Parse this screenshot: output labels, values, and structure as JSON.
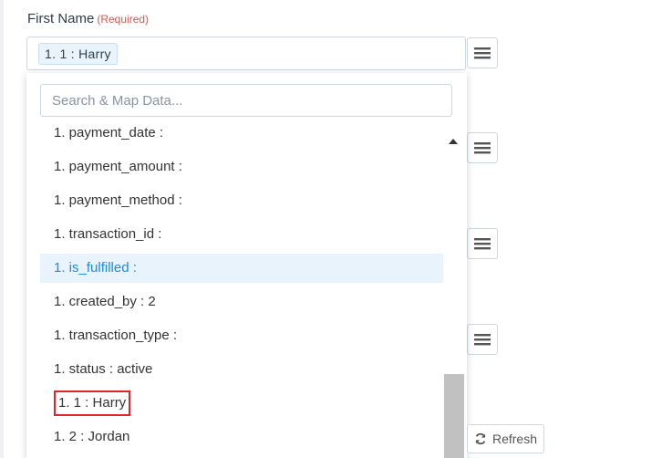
{
  "field": {
    "label": "First Name",
    "required_tag": "(Required)",
    "chip_value": "1. 1 : Harry"
  },
  "dropdown": {
    "search_placeholder": "Search & Map Data...",
    "items": [
      {
        "label": "1. payment_date :"
      },
      {
        "label": "1. payment_amount :"
      },
      {
        "label": "1. payment_method :"
      },
      {
        "label": "1. transaction_id :"
      },
      {
        "label": "1. is_fulfilled :",
        "highlighted": true
      },
      {
        "label": "1. created_by : 2"
      },
      {
        "label": "1. transaction_type :"
      },
      {
        "label": "1. status : active"
      },
      {
        "label": "1. 1 : Harry",
        "annotated": true
      },
      {
        "label": "1. 2 : Jordan"
      }
    ]
  },
  "buttons": {
    "refresh_label": "Refresh"
  },
  "icons": {
    "menu": "hamburger-menu-icon",
    "refresh": "refresh-icon",
    "scroll_up": "scroll-up-arrow-icon"
  },
  "colors": {
    "highlight_bg": "#e8f3fc",
    "highlight_text": "#1f8ae0",
    "required": "#d9534f",
    "annotation_box": "#e0242b"
  }
}
